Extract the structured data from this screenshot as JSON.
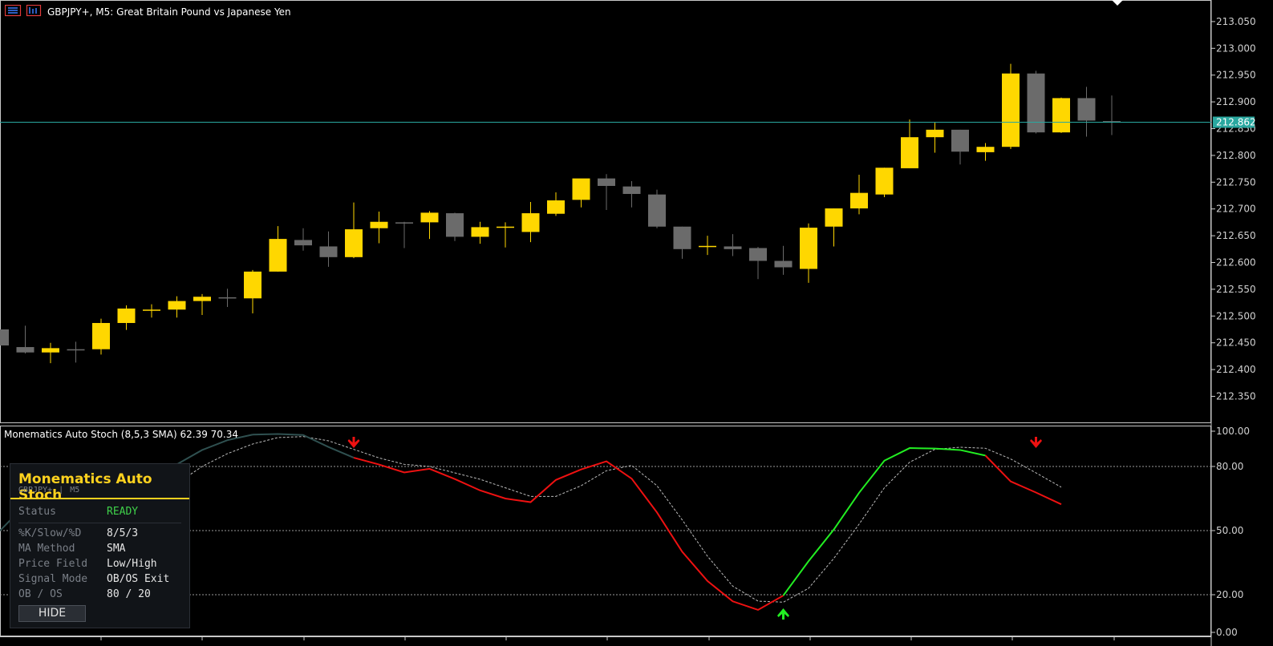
{
  "header": {
    "title": "GBPJPY+, M5:  Great Britain Pound vs Japanese Yen"
  },
  "indicator": {
    "label": "Monematics Auto Stoch (8,5,3 SMA) 62.39 70.34"
  },
  "colors": {
    "bull": "#ffd700",
    "bear": "#6b6b6b",
    "main_line_up": "#22ee22",
    "main_line_down": "#ee1111",
    "main_line_neutral": "#2f5050",
    "signal_line": "#bbbbbb",
    "bid_line": "#2aa8a0",
    "arrow_up": "#22ee22",
    "arrow_down": "#ee1111"
  },
  "panel": {
    "title": "Monematics  Auto Stoch",
    "symbol": "GBPJPY+",
    "timeframe": "M5",
    "rows": [
      {
        "key": "Status",
        "value": "READY"
      },
      {
        "key": "%K/Slow/%D",
        "value": "8/5/3"
      },
      {
        "key": "MA Method",
        "value": "SMA"
      },
      {
        "key": "Price Field",
        "value": "Low/High"
      },
      {
        "key": "Signal Mode",
        "value": "OB/OS Exit"
      },
      {
        "key": "OB / OS",
        "value": "80 / 20"
      }
    ],
    "hide_label": "HIDE"
  },
  "chart_data": [
    {
      "type": "candlestick",
      "title": "GBPJPY+, M5:  Great Britain Pound vs Japanese Yen",
      "ylim": [
        212.3,
        213.07
      ],
      "y_ticks": [
        "213.050",
        "213.000",
        "212.950",
        "212.900",
        "212.850",
        "212.800",
        "212.750",
        "212.700",
        "212.650",
        "212.600",
        "212.550",
        "212.500",
        "212.450",
        "212.400",
        "212.350"
      ],
      "current_price": "212.862",
      "candles": [
        {
          "o": 212.475,
          "h": 212.475,
          "l": 212.445,
          "c": 212.445
        },
        {
          "o": 212.442,
          "h": 212.482,
          "l": 212.43,
          "c": 212.432
        },
        {
          "o": 212.432,
          "h": 212.45,
          "l": 212.412,
          "c": 212.44
        },
        {
          "o": 212.438,
          "h": 212.452,
          "l": 212.413,
          "c": 212.436
        },
        {
          "o": 212.438,
          "h": 212.495,
          "l": 212.428,
          "c": 212.487
        },
        {
          "o": 212.487,
          "h": 212.52,
          "l": 212.474,
          "c": 212.514
        },
        {
          "o": 212.512,
          "h": 212.522,
          "l": 212.497,
          "c": 212.512
        },
        {
          "o": 212.512,
          "h": 212.537,
          "l": 212.497,
          "c": 212.528
        },
        {
          "o": 212.528,
          "h": 212.541,
          "l": 212.502,
          "c": 212.536
        },
        {
          "o": 212.535,
          "h": 212.551,
          "l": 212.517,
          "c": 212.533
        },
        {
          "o": 212.533,
          "h": 212.586,
          "l": 212.505,
          "c": 212.583
        },
        {
          "o": 212.583,
          "h": 212.668,
          "l": 212.583,
          "c": 212.644
        },
        {
          "o": 212.642,
          "h": 212.664,
          "l": 212.622,
          "c": 212.632
        },
        {
          "o": 212.63,
          "h": 212.658,
          "l": 212.592,
          "c": 212.61
        },
        {
          "o": 212.61,
          "h": 212.712,
          "l": 212.608,
          "c": 212.662
        },
        {
          "o": 212.664,
          "h": 212.695,
          "l": 212.636,
          "c": 212.676
        },
        {
          "o": 212.675,
          "h": 212.676,
          "l": 212.627,
          "c": 212.674
        },
        {
          "o": 212.675,
          "h": 212.696,
          "l": 212.644,
          "c": 212.693
        },
        {
          "o": 212.692,
          "h": 212.693,
          "l": 212.64,
          "c": 212.648
        },
        {
          "o": 212.648,
          "h": 212.676,
          "l": 212.635,
          "c": 212.666
        },
        {
          "o": 212.665,
          "h": 212.675,
          "l": 212.628,
          "c": 212.667
        },
        {
          "o": 212.657,
          "h": 212.713,
          "l": 212.638,
          "c": 212.692
        },
        {
          "o": 212.691,
          "h": 212.731,
          "l": 212.687,
          "c": 212.716
        },
        {
          "o": 212.717,
          "h": 212.756,
          "l": 212.703,
          "c": 212.757
        },
        {
          "o": 212.757,
          "h": 212.765,
          "l": 212.698,
          "c": 212.743
        },
        {
          "o": 212.742,
          "h": 212.752,
          "l": 212.703,
          "c": 212.728
        },
        {
          "o": 212.727,
          "h": 212.736,
          "l": 212.664,
          "c": 212.667
        },
        {
          "o": 212.667,
          "h": 212.667,
          "l": 212.607,
          "c": 212.625
        },
        {
          "o": 212.629,
          "h": 212.65,
          "l": 212.614,
          "c": 212.631
        },
        {
          "o": 212.63,
          "h": 212.653,
          "l": 212.612,
          "c": 212.625
        },
        {
          "o": 212.627,
          "h": 212.629,
          "l": 212.569,
          "c": 212.603
        },
        {
          "o": 212.603,
          "h": 212.631,
          "l": 212.577,
          "c": 212.591
        },
        {
          "o": 212.588,
          "h": 212.673,
          "l": 212.562,
          "c": 212.665
        },
        {
          "o": 212.667,
          "h": 212.701,
          "l": 212.63,
          "c": 212.701
        },
        {
          "o": 212.701,
          "h": 212.764,
          "l": 212.69,
          "c": 212.73
        },
        {
          "o": 212.727,
          "h": 212.777,
          "l": 212.722,
          "c": 212.777
        },
        {
          "o": 212.776,
          "h": 212.867,
          "l": 212.776,
          "c": 212.834
        },
        {
          "o": 212.834,
          "h": 212.861,
          "l": 212.805,
          "c": 212.848
        },
        {
          "o": 212.848,
          "h": 212.848,
          "l": 212.783,
          "c": 212.807
        },
        {
          "o": 212.806,
          "h": 212.823,
          "l": 212.79,
          "c": 212.816
        },
        {
          "o": 212.816,
          "h": 212.971,
          "l": 212.812,
          "c": 212.953
        },
        {
          "o": 212.953,
          "h": 212.958,
          "l": 212.841,
          "c": 212.843
        },
        {
          "o": 212.843,
          "h": 212.908,
          "l": 212.842,
          "c": 212.907
        },
        {
          "o": 212.907,
          "h": 212.928,
          "l": 212.835,
          "c": 212.865
        },
        {
          "o": 212.864,
          "h": 212.912,
          "l": 212.838,
          "c": 212.862
        }
      ]
    },
    {
      "type": "line",
      "title": "Monematics Auto Stoch (8,5,3 SMA) 62.39 70.34",
      "ylim": [
        0,
        100
      ],
      "y_ticks": [
        "100.00",
        "80.00",
        "50.00",
        "20.00",
        "0.00"
      ],
      "levels": [
        80,
        50,
        20
      ],
      "series": [
        {
          "role": "main",
          "points": [
            [
              0.0,
              50.0
            ],
            [
              1.5,
              68.0
            ],
            [
              4.5,
              68.0
            ],
            [
              6.0,
              75.5
            ],
            [
              7.0,
              81.0
            ],
            [
              8.0,
              87.7
            ],
            [
              9.0,
              92.3
            ],
            [
              10.0,
              94.9
            ],
            [
              11.0,
              95.2
            ],
            [
              12.0,
              94.7
            ],
            [
              13.0,
              89.1
            ],
            [
              14.0,
              84.1
            ],
            [
              15.0,
              80.9
            ],
            [
              16.0,
              77.2
            ],
            [
              17.0,
              78.9
            ],
            [
              18.0,
              74.1
            ],
            [
              19.0,
              68.8
            ],
            [
              20.0,
              65.0
            ],
            [
              21.0,
              63.3
            ],
            [
              22.0,
              73.7
            ],
            [
              23.0,
              78.6
            ],
            [
              24.0,
              82.4
            ],
            [
              25.0,
              74.3
            ],
            [
              26.0,
              58.5
            ],
            [
              27.0,
              40.1
            ],
            [
              28.0,
              26.4
            ],
            [
              29.0,
              16.9
            ],
            [
              30.0,
              12.9
            ],
            [
              31.0,
              19.6
            ],
            [
              32.0,
              35.7
            ],
            [
              33.0,
              50.5
            ],
            [
              34.0,
              67.7
            ],
            [
              35.0,
              82.7
            ],
            [
              36.0,
              88.6
            ],
            [
              37.0,
              88.4
            ],
            [
              38.0,
              87.7
            ],
            [
              39.0,
              85.1
            ],
            [
              40.0,
              73.0
            ],
            [
              41.0,
              67.8
            ],
            [
              42.0,
              62.3
            ]
          ],
          "segments": [
            {
              "from": 0,
              "to": 10,
              "color": "neutral"
            },
            {
              "from": 10,
              "to": 14,
              "color": "neutral"
            },
            {
              "from": 14,
              "to": 31,
              "color": "down"
            },
            {
              "from": 31,
              "to": 37,
              "color": "up"
            },
            {
              "from": 37,
              "to": 39,
              "color": "up"
            },
            {
              "from": 39,
              "to": 42,
              "color": "down"
            }
          ]
        },
        {
          "role": "signal",
          "points": [
            [
              5.0,
              54.0
            ],
            [
              6.0,
              63.0
            ],
            [
              7.0,
              72.0
            ],
            [
              8.0,
              80.0
            ],
            [
              9.0,
              86.0
            ],
            [
              10.0,
              90.5
            ],
            [
              11.0,
              93.5
            ],
            [
              12.0,
              94.0
            ],
            [
              13.0,
              92.0
            ],
            [
              14.0,
              88.0
            ],
            [
              15.0,
              84.0
            ],
            [
              16.0,
              81.0
            ],
            [
              17.0,
              80.0
            ],
            [
              18.0,
              77.0
            ],
            [
              19.0,
              74.0
            ],
            [
              20.0,
              70.0
            ],
            [
              21.0,
              66.0
            ],
            [
              22.0,
              66.0
            ],
            [
              23.0,
              71.0
            ],
            [
              24.0,
              78.0
            ],
            [
              25.0,
              80.5
            ],
            [
              26.0,
              71.0
            ],
            [
              27.0,
              55.0
            ],
            [
              28.0,
              38.0
            ],
            [
              29.0,
              24.0
            ],
            [
              30.0,
              17.0
            ],
            [
              31.0,
              16.5
            ],
            [
              32.0,
              23.0
            ],
            [
              33.0,
              37.0
            ],
            [
              34.0,
              53.0
            ],
            [
              35.0,
              70.0
            ],
            [
              36.0,
              82.0
            ],
            [
              37.0,
              88.0
            ],
            [
              38.0,
              89.0
            ],
            [
              39.0,
              88.5
            ],
            [
              40.0,
              83.5
            ],
            [
              41.0,
              77.0
            ],
            [
              42.0,
              70.3
            ]
          ]
        }
      ],
      "arrows": [
        {
          "x": 14.0,
          "dir": "down"
        },
        {
          "x": 31.0,
          "dir": "up"
        },
        {
          "x": 41.0,
          "dir": "down"
        }
      ]
    }
  ]
}
